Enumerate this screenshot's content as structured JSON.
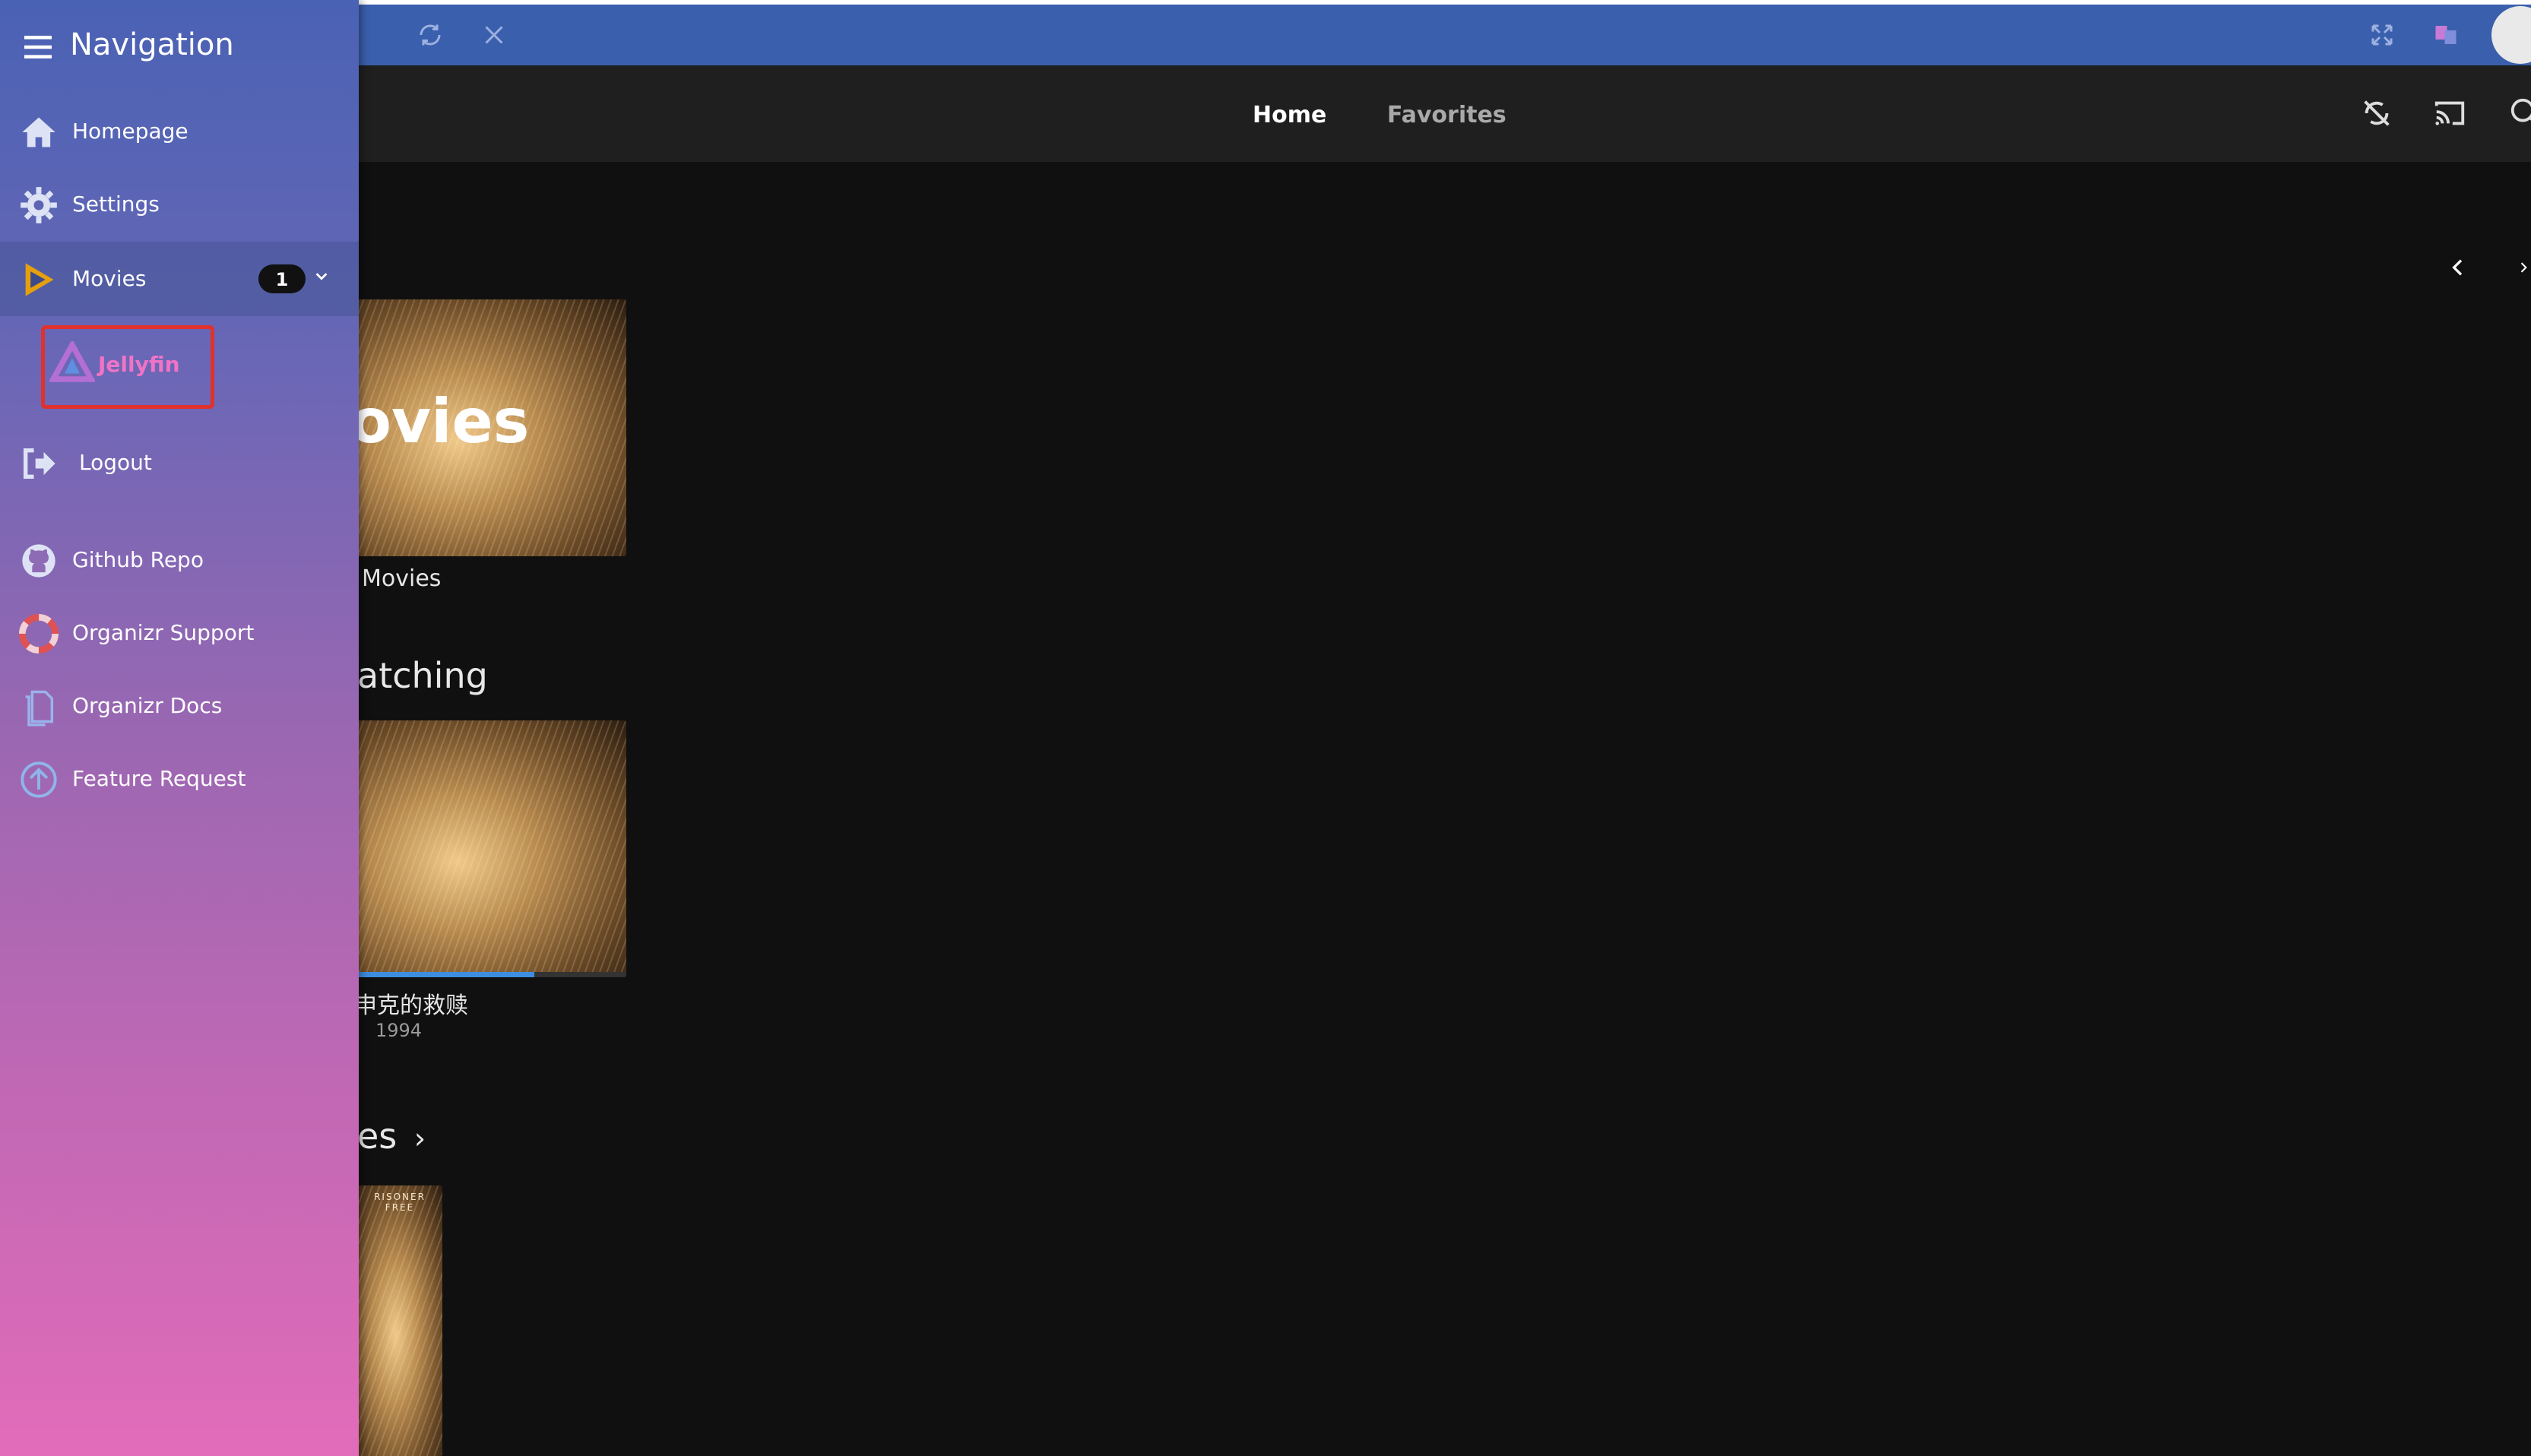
{
  "browser_bar": {
    "color": "#3a5fad",
    "icons": [
      "refresh-icon",
      "close-icon",
      "fullscreen-icon",
      "translate-icon",
      "user-avatar"
    ]
  },
  "app_header": {
    "tabs": [
      {
        "label": "Home",
        "active": true
      },
      {
        "label": "Favorites",
        "active": false
      }
    ],
    "icons": [
      "sync-disabled-icon",
      "cast-icon",
      "search-icon"
    ]
  },
  "content": {
    "library_card": {
      "overlay_text": "ovies",
      "label": "Movies"
    },
    "continue_watching": {
      "title": "atching",
      "item": {
        "title": "申克的救赎",
        "year": "1994",
        "progress": 0.7
      }
    },
    "latest": {
      "title": "es",
      "poster_text": "RISONER FREE"
    }
  },
  "sidebar": {
    "title": "Navigation",
    "items": [
      {
        "label": "Homepage",
        "icon": "home-icon"
      },
      {
        "label": "Settings",
        "icon": "gear-icon"
      },
      {
        "label": "Movies",
        "icon": "plex-play-icon",
        "badge": "1"
      },
      {
        "label": "Jellyfin",
        "icon": "jellyfin-icon"
      },
      {
        "label": "Logout",
        "icon": "logout-icon"
      },
      {
        "label": "Github Repo",
        "icon": "github-icon"
      },
      {
        "label": "Organizr Support",
        "icon": "lifebuoy-icon"
      },
      {
        "label": "Organizr Docs",
        "icon": "docs-icon"
      },
      {
        "label": "Feature Request",
        "icon": "arrow-up-circle-icon"
      }
    ],
    "highlight_color": "#e0312e"
  }
}
